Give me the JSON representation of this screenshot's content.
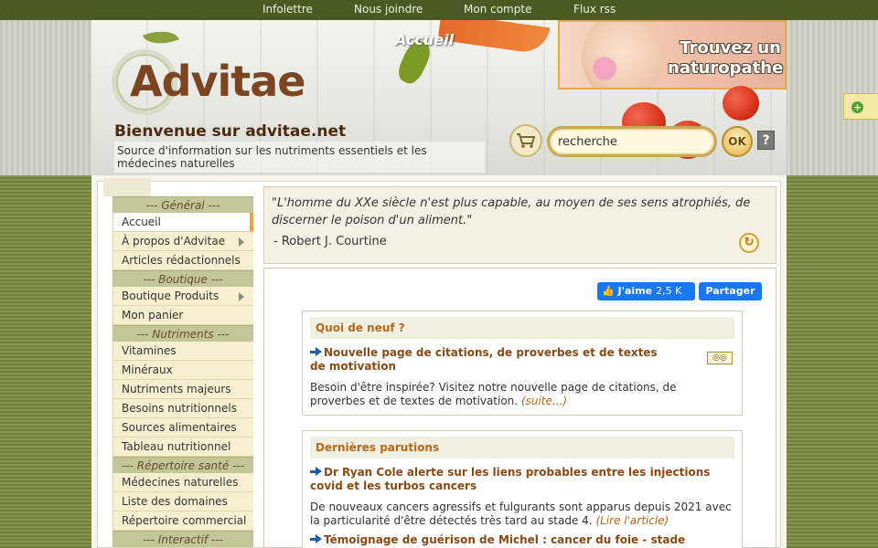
{
  "topnav": {
    "items": [
      "Infolettre",
      "Nous joindre",
      "Mon compte",
      "Flux rss"
    ]
  },
  "header": {
    "logo_text": "Advitae",
    "accueil_label": "Accueil",
    "promo_text": "Trouvez un naturopathe",
    "welcome": "Bienvenue sur advitae.net",
    "tagline": "Source d'information sur les nutriments essentiels et les médecines naturelles"
  },
  "search": {
    "value": "recherche",
    "ok_label": "OK",
    "help_label": "?"
  },
  "side_tab": {
    "icon": "plus-icon"
  },
  "nav": {
    "sections": [
      {
        "title": "--- Général ---",
        "items": [
          {
            "label": "Accueil",
            "active": true,
            "submenu": false
          },
          {
            "label": "À propos d'Advitae",
            "submenu": true
          },
          {
            "label": "Articles rédactionnels",
            "submenu": false
          }
        ]
      },
      {
        "title": "--- Boutique ---",
        "items": [
          {
            "label": "Boutique Produits",
            "submenu": true
          },
          {
            "label": "Mon panier",
            "submenu": false
          }
        ]
      },
      {
        "title": "--- Nutriments ---",
        "items": [
          {
            "label": "Vitamines"
          },
          {
            "label": "Minéraux"
          },
          {
            "label": "Nutriments majeurs"
          },
          {
            "label": "Besoins nutritionnels"
          },
          {
            "label": "Sources alimentaires"
          },
          {
            "label": "Tableau nutritionnel"
          }
        ]
      },
      {
        "title": "--- Répertoire santé ---",
        "items": [
          {
            "label": "Médecines naturelles"
          },
          {
            "label": "Liste des domaines"
          },
          {
            "label": "Répertoire commercial"
          }
        ]
      },
      {
        "title": "--- Interactif ---",
        "items": []
      }
    ]
  },
  "quote": {
    "text": "L'homme du XXe siècle n'est plus capable, au moyen de ses sens atrophiés, de discerner le poison d'un aliment.",
    "author": "- Robert J. Courtine"
  },
  "social": {
    "like_label": "J'aime",
    "like_count": "2,5 K",
    "share_label": "Partager"
  },
  "news": {
    "title": "Quoi de neuf ?",
    "article_title": "Nouvelle page de citations, de proverbes et de textes de motivation",
    "article_desc": "Besoin d'être inspirée? Visitez notre nouvelle page de citations, de proverbes et de textes de motivation.",
    "more_label": "(suite...)"
  },
  "latest": {
    "title": "Dernières parutions",
    "articles": [
      {
        "title": "Dr Ryan Cole alerte sur les liens probables entre les injections covid et les turbos cancers",
        "desc": "De nouveaux cancers agressifs et fulgurants sont apparus depuis 2021 avec la particularité d'être détectés très tard au stade 4.",
        "more": "(Lire l'article)"
      },
      {
        "title": "Témoignage de guérison de Michel : cancer du foie - stade",
        "desc": "",
        "more": ""
      }
    ]
  }
}
